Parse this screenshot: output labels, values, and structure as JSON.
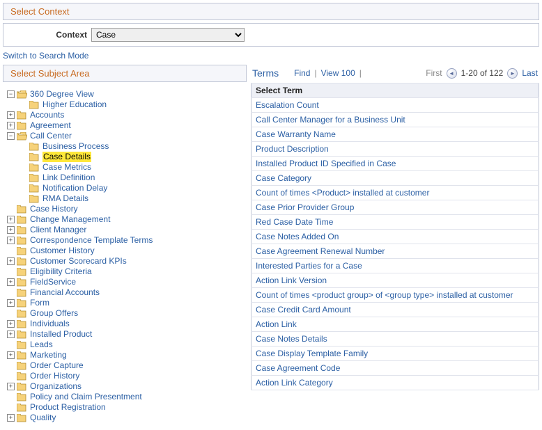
{
  "context_section_title": "Select Context",
  "context_label": "Context",
  "context_value": "Case",
  "switch_link": "Switch to Search Mode",
  "subject_section_title": "Select Subject Area",
  "tree": [
    {
      "label": "360 Degree View",
      "indent": 0,
      "exp": "minus",
      "icon": "open"
    },
    {
      "label": "Higher Education",
      "indent": 1,
      "exp": "none",
      "icon": "closed"
    },
    {
      "label": "Accounts",
      "indent": 0,
      "exp": "plus",
      "icon": "closed"
    },
    {
      "label": "Agreement",
      "indent": 0,
      "exp": "plus",
      "icon": "closed"
    },
    {
      "label": "Call Center",
      "indent": 0,
      "exp": "minus",
      "icon": "open"
    },
    {
      "label": "Business Process",
      "indent": 1,
      "exp": "none",
      "icon": "closed"
    },
    {
      "label": "Case Details",
      "indent": 1,
      "exp": "none",
      "icon": "closed",
      "hl": true
    },
    {
      "label": "Case Metrics",
      "indent": 1,
      "exp": "none",
      "icon": "closed"
    },
    {
      "label": "Link Definition",
      "indent": 1,
      "exp": "none",
      "icon": "closed"
    },
    {
      "label": "Notification Delay",
      "indent": 1,
      "exp": "none",
      "icon": "closed"
    },
    {
      "label": "RMA Details",
      "indent": 1,
      "exp": "none",
      "icon": "closed"
    },
    {
      "label": "Case History",
      "indent": 0,
      "exp": "none",
      "icon": "closed"
    },
    {
      "label": "Change Management",
      "indent": 0,
      "exp": "plus",
      "icon": "closed"
    },
    {
      "label": "Client Manager",
      "indent": 0,
      "exp": "plus",
      "icon": "closed"
    },
    {
      "label": "Correspondence Template Terms",
      "indent": 0,
      "exp": "plus",
      "icon": "closed"
    },
    {
      "label": "Customer History",
      "indent": 0,
      "exp": "none",
      "icon": "closed"
    },
    {
      "label": "Customer Scorecard KPIs",
      "indent": 0,
      "exp": "plus",
      "icon": "closed"
    },
    {
      "label": "Eligibility Criteria",
      "indent": 0,
      "exp": "none",
      "icon": "closed"
    },
    {
      "label": "FieldService",
      "indent": 0,
      "exp": "plus",
      "icon": "closed"
    },
    {
      "label": "Financial Accounts",
      "indent": 0,
      "exp": "none",
      "icon": "closed"
    },
    {
      "label": "Form",
      "indent": 0,
      "exp": "plus",
      "icon": "closed"
    },
    {
      "label": "Group Offers",
      "indent": 0,
      "exp": "none",
      "icon": "closed"
    },
    {
      "label": "Individuals",
      "indent": 0,
      "exp": "plus",
      "icon": "closed"
    },
    {
      "label": "Installed Product",
      "indent": 0,
      "exp": "plus",
      "icon": "closed"
    },
    {
      "label": "Leads",
      "indent": 0,
      "exp": "none",
      "icon": "closed"
    },
    {
      "label": "Marketing",
      "indent": 0,
      "exp": "plus",
      "icon": "closed"
    },
    {
      "label": "Order Capture",
      "indent": 0,
      "exp": "none",
      "icon": "closed"
    },
    {
      "label": "Order History",
      "indent": 0,
      "exp": "none",
      "icon": "closed"
    },
    {
      "label": "Organizations",
      "indent": 0,
      "exp": "plus",
      "icon": "closed"
    },
    {
      "label": "Policy and Claim Presentment",
      "indent": 0,
      "exp": "none",
      "icon": "closed"
    },
    {
      "label": "Product Registration",
      "indent": 0,
      "exp": "none",
      "icon": "closed"
    },
    {
      "label": "Quality",
      "indent": 0,
      "exp": "plus",
      "icon": "closed"
    }
  ],
  "terms": {
    "title": "Terms",
    "find": "Find",
    "view100": "View 100",
    "first": "First",
    "range": "1-20 of 122",
    "last": "Last",
    "header": "Select Term",
    "rows": [
      "Escalation Count",
      "Call Center Manager for a Business Unit",
      "Case Warranty Name",
      "Product Description",
      "Installed Product ID Specified in Case",
      "Case Category",
      "Count of times <Product> installed at customer",
      "Case Prior Provider Group",
      "Red Case Date Time",
      "Case Notes Added On",
      "Case Agreement Renewal Number",
      "Interested Parties for a Case",
      "Action Link Version",
      "Count of times <product group> of <group type> installed at customer",
      "Case Credit Card Amount",
      "Action Link",
      "Case Notes Details",
      "Case Display Template Family",
      "Case Agreement Code",
      "Action Link Category"
    ]
  }
}
